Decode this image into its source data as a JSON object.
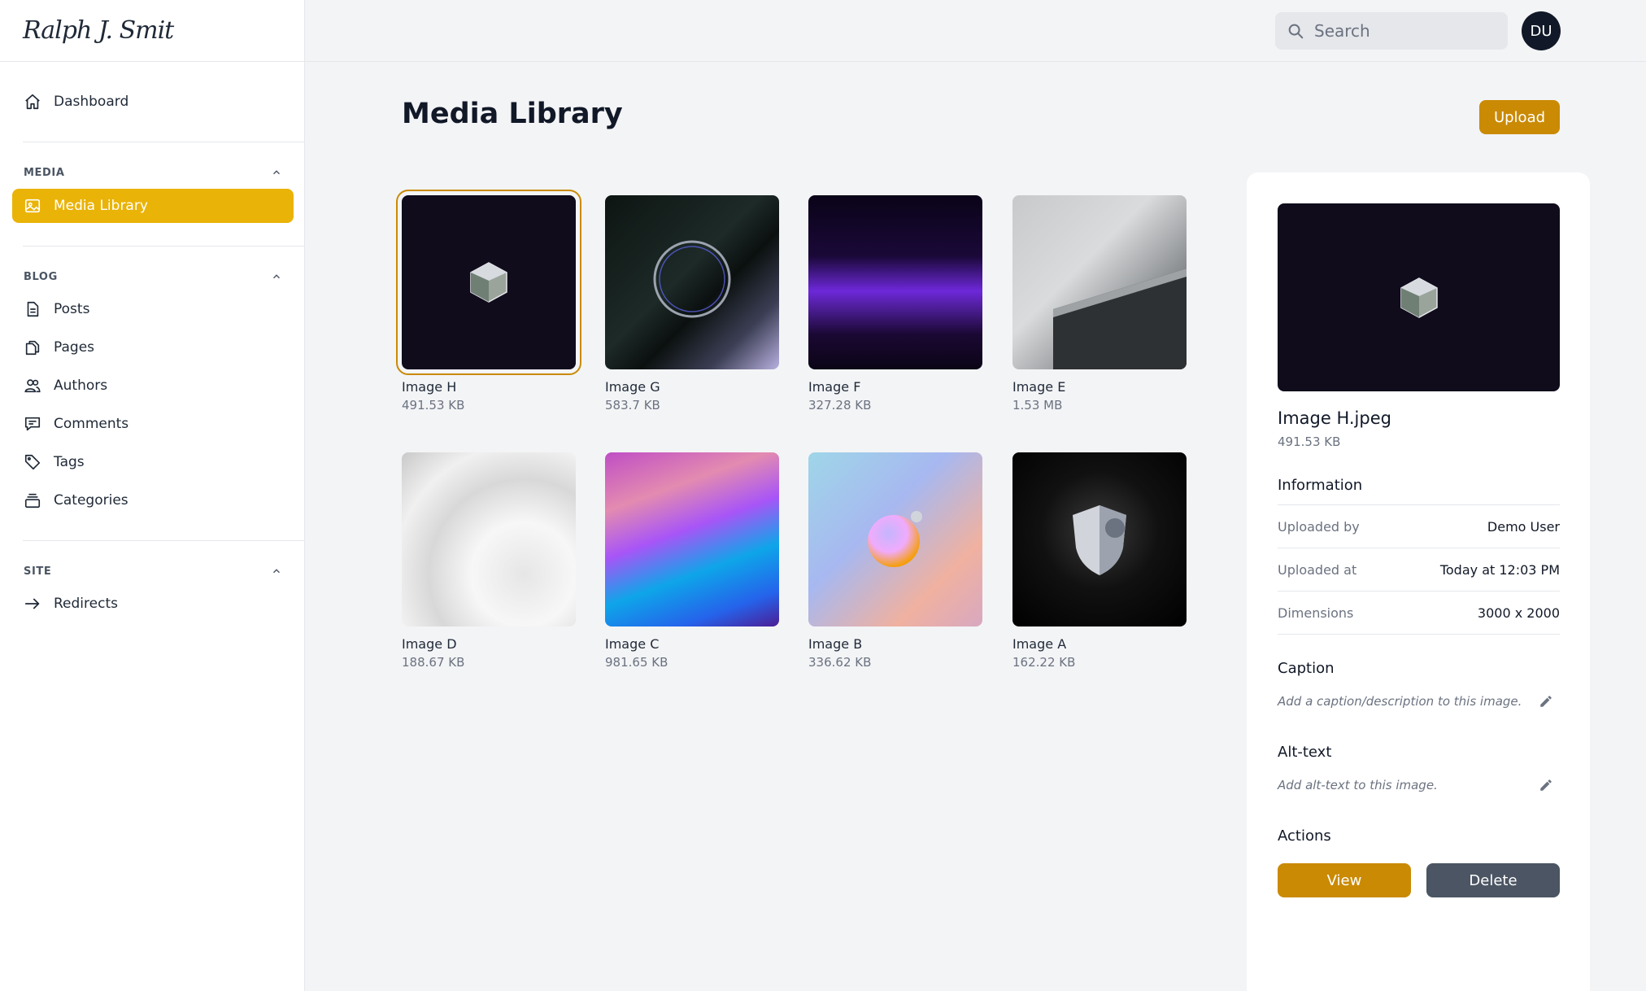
{
  "logo": "Ralph J. Smit",
  "sidebar": {
    "dashboard": "Dashboard",
    "groups": {
      "media": {
        "label": "MEDIA",
        "items": [
          "Media Library"
        ]
      },
      "blog": {
        "label": "BLOG",
        "items": [
          "Posts",
          "Pages",
          "Authors",
          "Comments",
          "Tags",
          "Categories"
        ]
      },
      "site": {
        "label": "SITE",
        "items": [
          "Redirects"
        ]
      }
    }
  },
  "topbar": {
    "search_placeholder": "Search",
    "avatar_initials": "DU"
  },
  "main": {
    "title": "Media Library",
    "upload_label": "Upload",
    "media": [
      {
        "name": "Image H",
        "size": "491.53 KB",
        "selected": true
      },
      {
        "name": "Image G",
        "size": "583.7 KB"
      },
      {
        "name": "Image F",
        "size": "327.28 KB"
      },
      {
        "name": "Image E",
        "size": "1.53 MB"
      },
      {
        "name": "Image D",
        "size": "188.67 KB"
      },
      {
        "name": "Image C",
        "size": "981.65 KB"
      },
      {
        "name": "Image B",
        "size": "336.62 KB"
      },
      {
        "name": "Image A",
        "size": "162.22 KB"
      }
    ]
  },
  "detail": {
    "filename": "Image H.jpeg",
    "size": "491.53 KB",
    "information_heading": "Information",
    "info": [
      {
        "key": "Uploaded by",
        "value": "Demo User"
      },
      {
        "key": "Uploaded at",
        "value": "Today at 12:03 PM"
      },
      {
        "key": "Dimensions",
        "value": "3000 x 2000"
      }
    ],
    "caption_heading": "Caption",
    "caption_placeholder": "Add a caption/description to this image.",
    "alt_heading": "Alt-text",
    "alt_placeholder": "Add alt-text to this image.",
    "actions_heading": "Actions",
    "view_label": "View",
    "delete_label": "Delete"
  },
  "colors": {
    "accent": "#eab308",
    "button": "#ca8a04",
    "delete": "#4b5563"
  }
}
